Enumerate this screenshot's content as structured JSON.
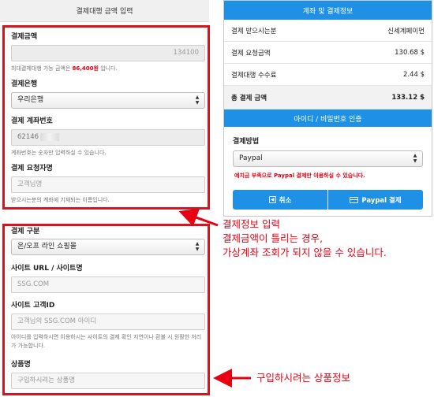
{
  "left": {
    "header": "결제대행 금액 입력",
    "amount": {
      "label": "결제금액",
      "value": "134100",
      "help_prefix": "최대결제대행 가능 금액은 ",
      "help_amount": "86,400원",
      "help_suffix": " 입니다."
    },
    "bank": {
      "label": "결제은행",
      "value": "우리은행"
    },
    "account": {
      "label": "결제 계좌번호",
      "value": "62146",
      "help": "계좌번호는 숫자만 입력하실 수 있습니다."
    },
    "requester": {
      "label": "결제 요청자명",
      "placeholder": "고객님명",
      "help": "받으시는분의 계좌에 기재되는 이름입니다."
    },
    "category": {
      "label": "결제 구분",
      "value": "온/오프 라인 쇼핑몰"
    },
    "site": {
      "label": "사이트 URL / 사이트명",
      "placeholder": "SSG.COM"
    },
    "site_id": {
      "label": "사이트 고객ID",
      "placeholder": "고객님의 SSG.COM 아이디",
      "help": "아이디를 입력하시면 이용하시는 사이트의 결제 확인 지연이나 환불 시 원활한 처리가 가능합니다."
    },
    "product": {
      "label": "상품명",
      "placeholder": "구입하시려는 상품명"
    }
  },
  "right": {
    "header": "계좌 및 결제정보",
    "rows": [
      {
        "label": "결제 받으시는분",
        "value": "신세계페이먼"
      },
      {
        "label": "결제 요청금액",
        "value": "130.68  $"
      },
      {
        "label": "결제대행 수수료",
        "value": "2.44  $"
      },
      {
        "label": "총 결제 금액",
        "value": "133.12  $"
      }
    ],
    "subheader": "아이디 / 비밀번호 인증",
    "method_label": "결제방법",
    "method_value": "Paypal",
    "warning": "예치금 부족으로 Paypal 결제만 이용하실 수 있습니다.",
    "cancel_label": "취소",
    "pay_label": "Paypal 결제"
  },
  "annotations": {
    "note1_line1": "결제정보 입력",
    "note1_line2": "결제금액이 틀리는 경우,",
    "note1_line3": "가상계좌 조회가 되지 않을 수 있습니다.",
    "note2": "구입하시려는 상품정보"
  },
  "colors": {
    "accent_blue": "#1e90e6",
    "annotation_red": "#e60012"
  }
}
